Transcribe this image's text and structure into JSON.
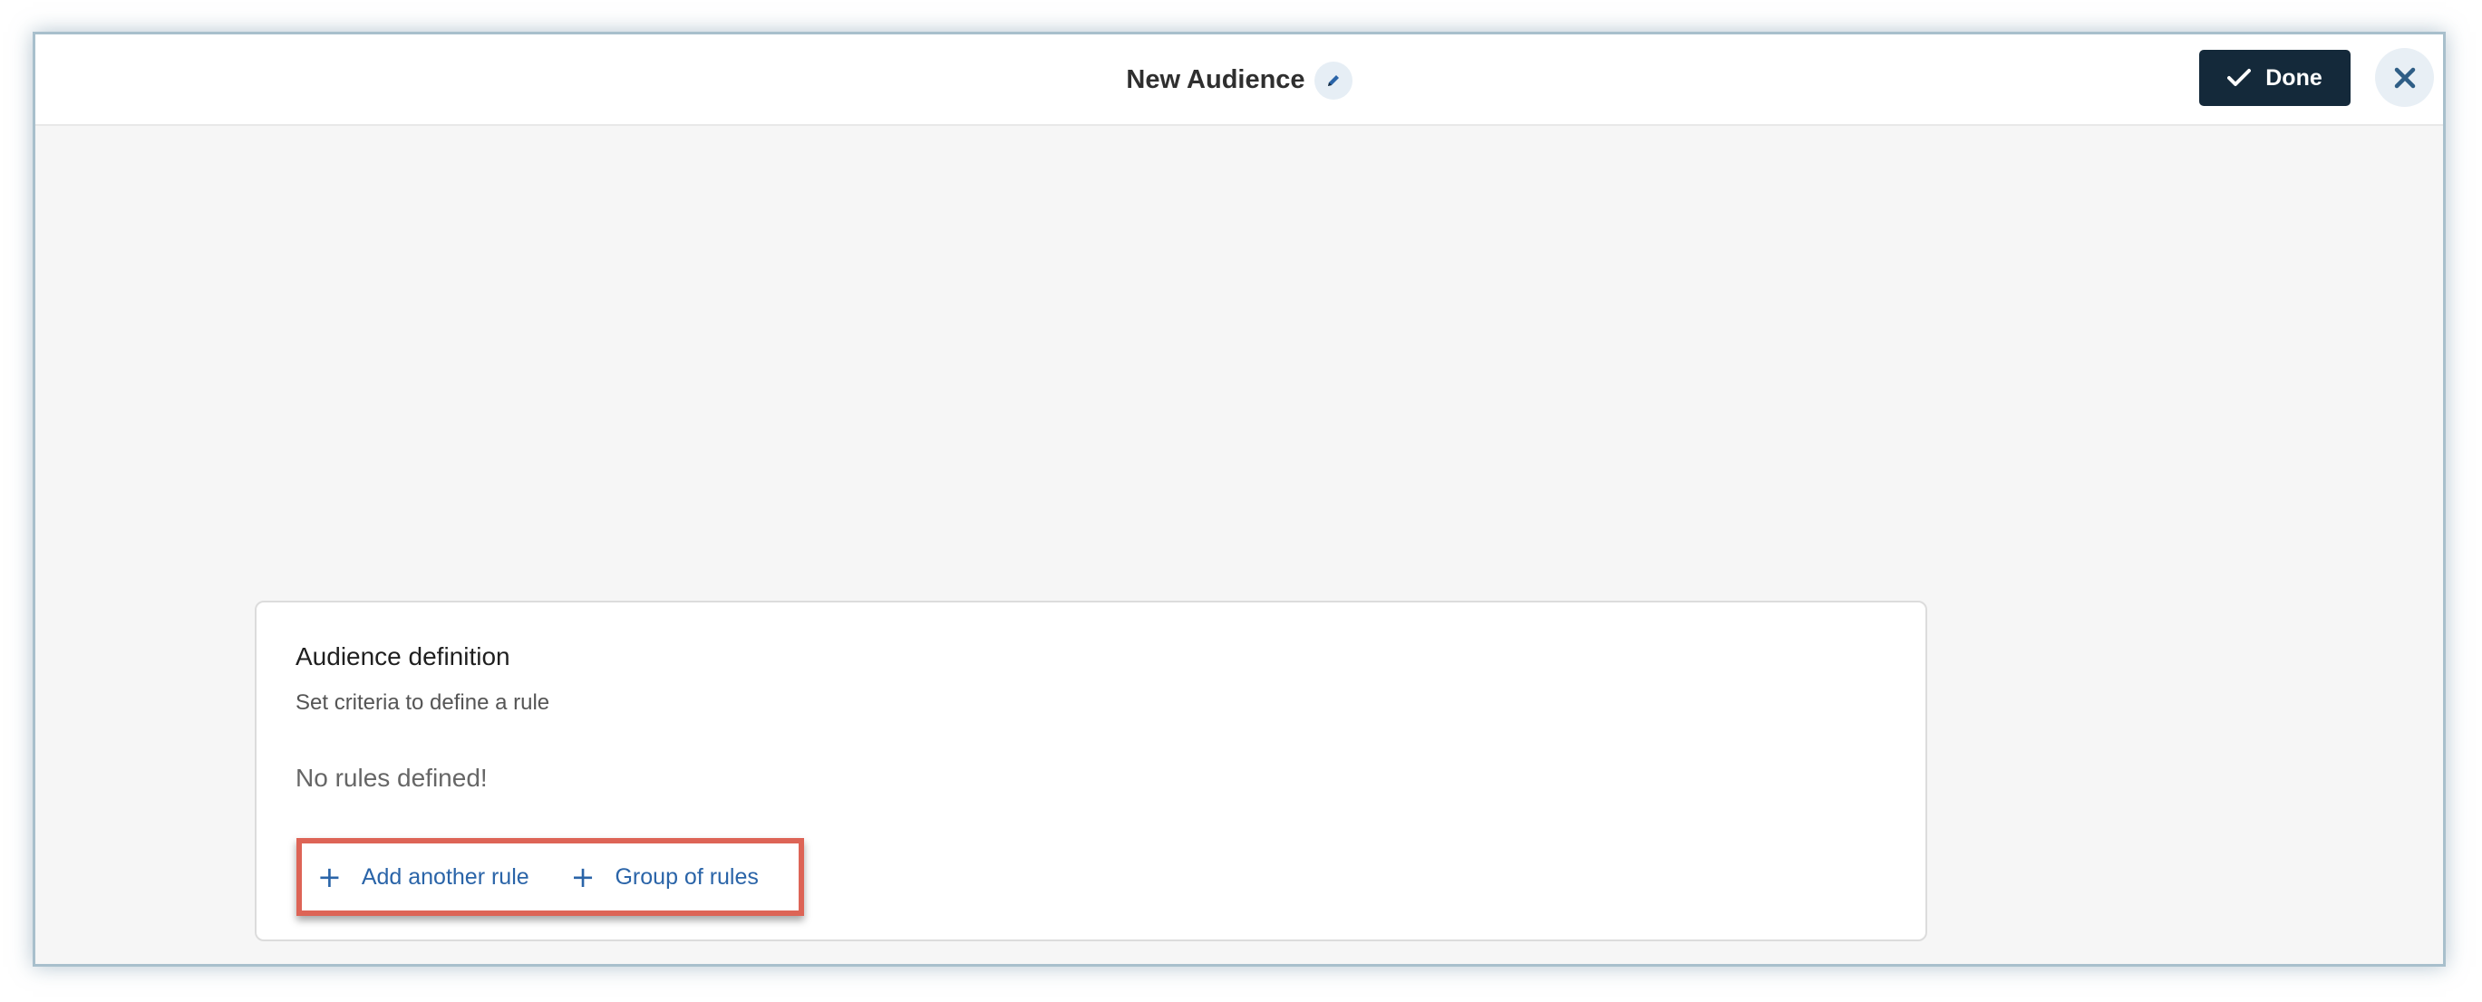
{
  "header": {
    "title": "New Audience",
    "edit_icon": "pencil-icon",
    "done_label": "Done",
    "done_icon": "checkmark-icon",
    "close_icon": "close-icon"
  },
  "card": {
    "title": "Audience definition",
    "subtitle": "Set criteria to define a rule",
    "empty_message": "No rules defined!",
    "actions": [
      {
        "label": "Add another rule",
        "icon": "plus-icon"
      },
      {
        "label": "Group of rules",
        "icon": "plus-icon"
      }
    ]
  },
  "colors": {
    "primary_dark": "#14293a",
    "link": "#2a64a8",
    "highlight": "#dd6456",
    "canvas": "#f6f6f6"
  }
}
